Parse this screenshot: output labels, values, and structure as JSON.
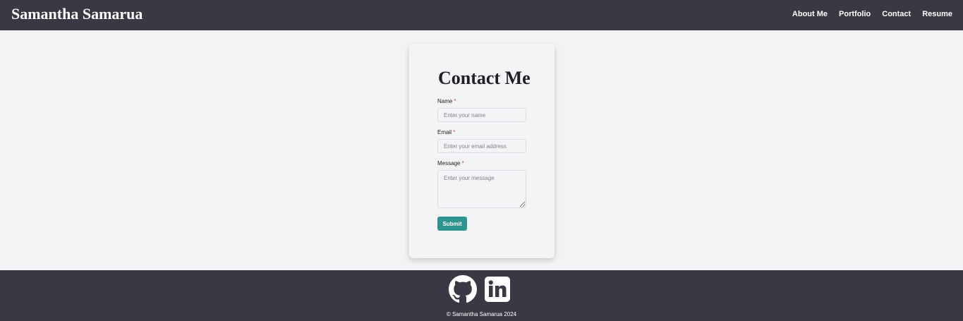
{
  "header": {
    "brand": "Samantha Samarua",
    "nav": [
      {
        "label": "About Me"
      },
      {
        "label": "Portfolio"
      },
      {
        "label": "Contact"
      },
      {
        "label": "Resume"
      }
    ]
  },
  "form": {
    "title": "Contact Me",
    "required_marker": "*",
    "name": {
      "label": "Name",
      "placeholder": "Enter your name",
      "value": ""
    },
    "email": {
      "label": "Email",
      "placeholder": "Enter your email address",
      "value": ""
    },
    "message": {
      "label": "Message",
      "placeholder": "Enter your message",
      "value": ""
    },
    "submit_label": "Submit"
  },
  "footer": {
    "social": [
      {
        "icon": "github-icon"
      },
      {
        "icon": "linkedin-icon"
      }
    ],
    "copyright": "© Samantha Samarua 2024"
  },
  "colors": {
    "header_bg": "#3a3943",
    "page_bg": "#f2f3f5",
    "accent": "#2f9490",
    "required": "#d43c3c"
  }
}
